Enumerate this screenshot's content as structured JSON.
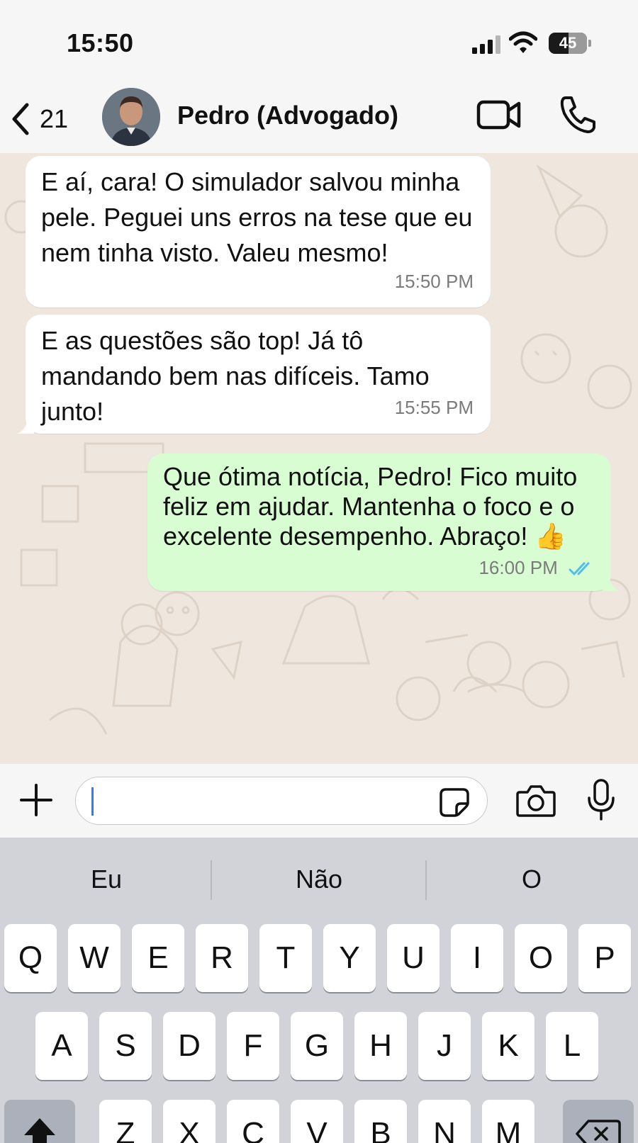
{
  "status_bar": {
    "time": "15:50",
    "battery": "45"
  },
  "header": {
    "back_count": "21",
    "contact_name": "Pedro (Advogado)"
  },
  "messages": [
    {
      "direction": "incoming",
      "text": "E aí, cara! O simulador salvou minha pele. Peguei uns erros na tese que eu nem tinha visto. Valeu mesmo!",
      "time": "15:50 PM"
    },
    {
      "direction": "incoming",
      "text": "E as questões são top! Já tô mandando bem nas difíceis. Tamo junto!",
      "time": "15:55 PM"
    },
    {
      "direction": "outgoing",
      "text": "Que ótima notícia, Pedro! Fico muito feliz em ajudar. Mantenha o foco e o excelente desempenho. Abraço! 👍",
      "time": "16:00 PM",
      "status": "read"
    }
  ],
  "input": {
    "value": ""
  },
  "keyboard": {
    "suggestions": [
      "Eu",
      "Não",
      "O"
    ],
    "row1": [
      "Q",
      "W",
      "E",
      "R",
      "T",
      "Y",
      "U",
      "I",
      "O",
      "P"
    ],
    "row2": [
      "A",
      "S",
      "D",
      "F",
      "G",
      "H",
      "J",
      "K",
      "L"
    ],
    "row3": [
      "Z",
      "X",
      "C",
      "V",
      "B",
      "N",
      "M"
    ]
  },
  "colors": {
    "incoming_bubble": "#ffffff",
    "outgoing_bubble": "#d9fdd3",
    "read_ticks": "#53bdeb",
    "chat_bg": "#efe7de"
  }
}
